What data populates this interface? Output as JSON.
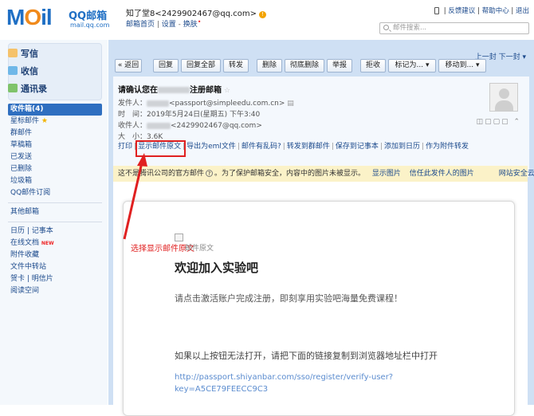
{
  "brand": {
    "logo": "MOil",
    "name": "QQ邮箱",
    "domain": "mail.qq.com"
  },
  "user": {
    "display": "知了堂8<2429902467@qq.com>",
    "links": [
      "邮箱首页",
      "设置",
      "换肤"
    ]
  },
  "top_links": [
    "反馈建议",
    "帮助中心",
    "退出"
  ],
  "search": {
    "placeholder": "邮件搜索..."
  },
  "sidebar": {
    "buttons": [
      "写信",
      "收信",
      "通讯录"
    ],
    "folders": [
      "收件箱(4)",
      "星标邮件",
      "群邮件",
      "草稿箱",
      "已发送",
      "已删除",
      "垃圾箱",
      "QQ邮件订阅"
    ],
    "others": [
      "其他邮箱"
    ],
    "apps_row1": [
      "日历",
      "记事本"
    ],
    "apps": [
      "在线文档",
      "附件收藏",
      "文件中转站"
    ],
    "apps_row2": [
      "贺卡",
      "明信片"
    ],
    "reading": "阅读空间",
    "new_badge": "NEW"
  },
  "toolbar": {
    "buttons": [
      "« 返回",
      "回复",
      "回复全部",
      "转发",
      "删除",
      "彻底删除",
      "举报",
      "拒收",
      "标记为... ▾",
      "移动到... ▾"
    ]
  },
  "nav": {
    "prev": "上一封",
    "next": "下一封"
  },
  "mail": {
    "subject_a": "请确认您在",
    "subject_b": "注册邮箱",
    "from_label": "发件人：",
    "from_addr": "<passport@simpleedu.com.cn>",
    "time_label": "时　间：",
    "time": "2019年5月24日(星期五) 下午3:40",
    "to_label": "收件人：",
    "to_addr": "<2429902467@qq.com>",
    "size_label": "大　小：",
    "size": "3.6K",
    "actions": [
      "打印",
      "显示邮件原文",
      "导出为eml文件",
      "邮件有乱码?",
      "转发到群邮件",
      "保存到记事本",
      "添加到日历",
      "作为附件转发"
    ]
  },
  "notice": {
    "text_a": "这不是腾讯公司的官方邮件",
    "text_b": "。为了保护邮箱安全，内容中的图片未被显示。",
    "show_images": "显示图片",
    "trust": "信任此发件人的图片",
    "cloud": "网站安全云检测"
  },
  "annotation": "选择显示邮件原文",
  "content": {
    "broken_img_text": "邮件原文",
    "welcome": "欢迎加入实验吧",
    "p1": "请点击激活账户完成注册，即刻享用实验吧海量免费课程！",
    "p2": "如果以上按钮无法打开，请把下面的链接复制到浏览器地址栏中打开",
    "link": "http://passport.shiyanbar.com/sso/register/verify-user?key=A5CE79FEECC9C3"
  },
  "colors": {
    "accent": "#2f6fc0",
    "annotation": "#e02020",
    "link": "#5b8ccf"
  }
}
